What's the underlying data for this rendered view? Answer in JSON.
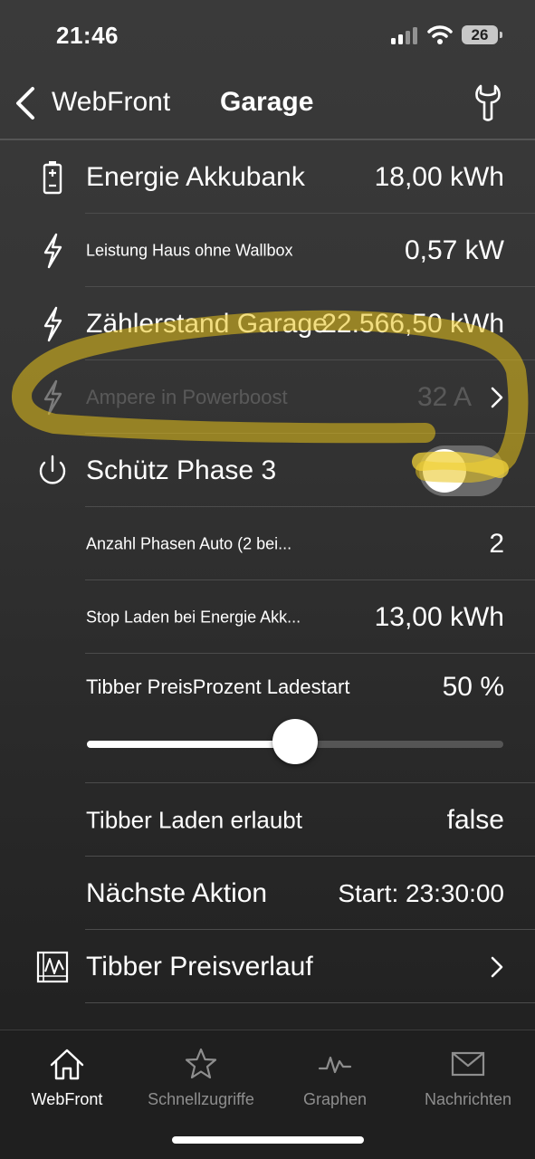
{
  "status_bar": {
    "time": "21:46",
    "battery": "26"
  },
  "nav": {
    "back_label": "WebFront",
    "title": "Garage"
  },
  "rows": [
    {
      "label": "Energie Akkubank",
      "value": "18,00 kWh",
      "icon": "battery-icon"
    },
    {
      "label": "Leistung Haus ohne Wallbox",
      "value": "0,57 kW",
      "icon": "lightning-icon"
    },
    {
      "label": "Zählerstand Garage",
      "value": "22.566,50 kWh",
      "icon": "lightning-icon"
    },
    {
      "label": "Ampere in Powerboost",
      "value": "32 A",
      "icon": "lightning-icon"
    },
    {
      "label": "Schütz Phase 3",
      "icon": "power-icon",
      "toggle_on": false
    },
    {
      "label": "Anzahl Phasen Auto (2 bei...",
      "value": "2"
    },
    {
      "label": "Stop Laden bei Energie Akk...",
      "value": "13,00 kWh"
    },
    {
      "label": "Tibber PreisProzent Ladestart",
      "value": "50 %",
      "slider_fraction": 0.5
    },
    {
      "label": "Tibber Laden erlaubt",
      "value": "false"
    },
    {
      "label": "Nächste Aktion",
      "value": "Start: 23:30:00"
    },
    {
      "label": "Tibber Preisverlauf",
      "icon": "chart-icon"
    }
  ],
  "tabbar": {
    "tabs": [
      {
        "label": "WebFront",
        "icon": "home-icon",
        "active": true
      },
      {
        "label": "Schnellzugriffe",
        "icon": "star-icon"
      },
      {
        "label": "Graphen",
        "icon": "graph-icon"
      },
      {
        "label": "Nachrichten",
        "icon": "mail-icon"
      }
    ]
  },
  "colors": {
    "highlight": "#e8c21a",
    "active_tab": "#ffffff",
    "inactive_tab": "#8e8e8e"
  }
}
